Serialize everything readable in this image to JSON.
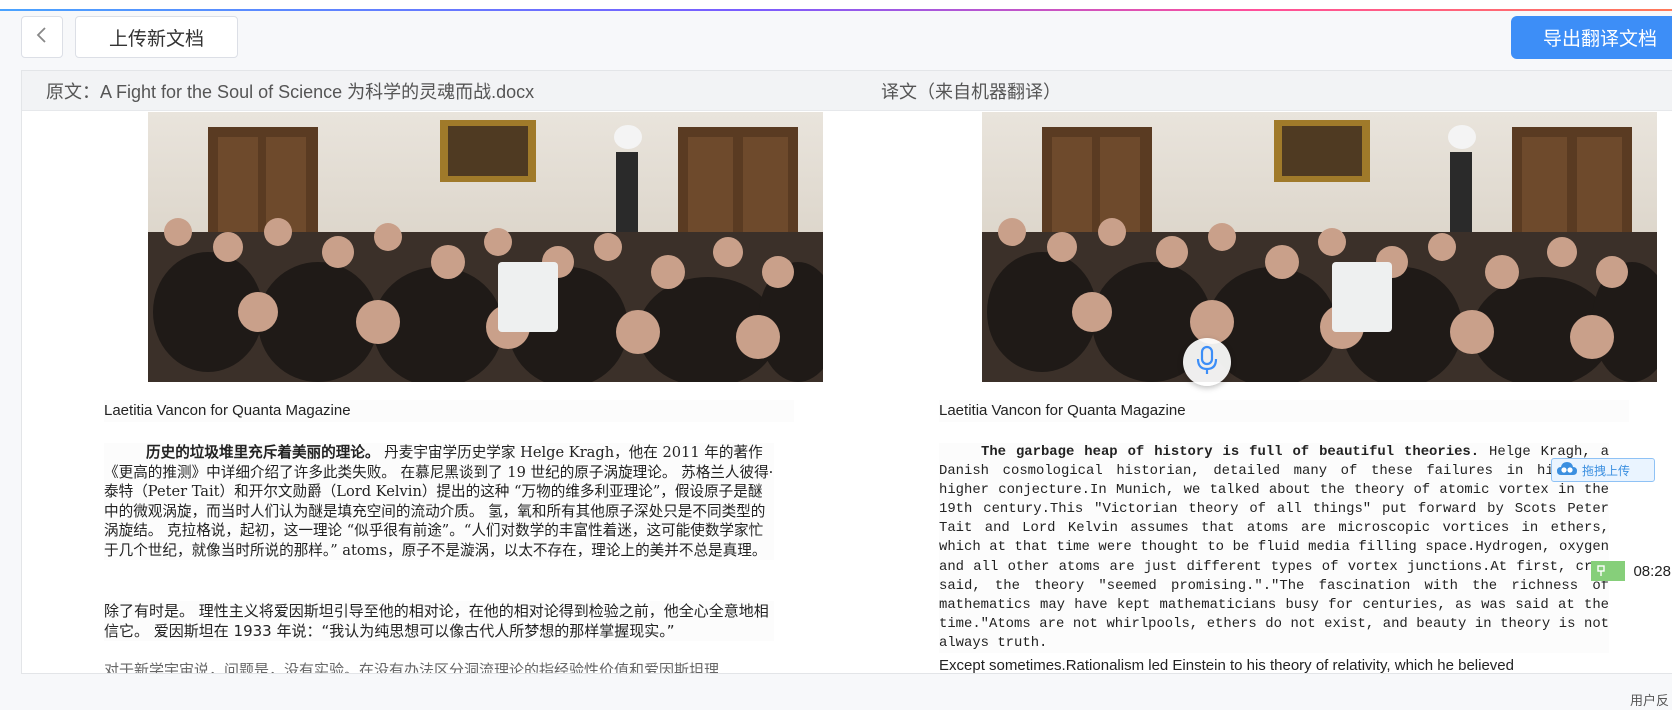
{
  "toolbar": {
    "upload_label": "上传新文档",
    "export_label": "导出翻译文档"
  },
  "colors": {
    "accent": "#3d8ef7",
    "time_badge": "#86cf7a"
  },
  "left_panel": {
    "header": "原文：A Fight for the Soul of Science 为科学的灵魂而战.docx",
    "photo_credit": "Laetitia Vancon for Quanta Magazine",
    "para1_bold": "历史的垃圾堆里充斥着美丽的理论。",
    "para1_rest": " 丹麦宇宙学历史学家 Helge Kragh，他在 2011 年的著作《更高的推测》中详细介绍了许多此类失败。 在慕尼黑谈到了 19 世纪的原子涡旋理论。 苏格兰人彼得·泰特（Peter Tait）和开尔文勋爵（Lord Kelvin）提出的这种 “万物的维多利亚理论”，假设原子是醚中的微观涡旋，而当时人们认为醚是填充空间的流动介质。 氢，氧和所有其他原子深处只是不同类型的涡旋结。 克拉格说，起初，这一理论 “似乎很有前途”。“人们对数学的丰富性着迷，这可能使数学家忙于几个世纪，就像当时所说的那样。” atoms，原子不是漩涡，以太不存在，理论上的美并不总是真理。",
    "para2": "除了有时是。 理性主义将爱因斯坦引导至他的相对论，在他的相对论得到检验之前，他全心全意地相信它。 爱因斯坦在 1933 年说：“我认为纯思想可以像古代人所梦想的那样掌握现实。”",
    "para3": "对于新学宇宙说，问题是，没有实验。在没有办法区分洞流理论的指经验性价值和爱因斯坦理"
  },
  "right_panel": {
    "header": "译文（来自机器翻译）",
    "photo_credit": "Laetitia Vancon for Quanta Magazine",
    "para1_bold": "The garbage heap of history is full of beautiful theories.",
    "para1_rest": " Helge Kragh, a Danish cosmological historian, detailed many of these failures in his Book higher conjecture.In Munich, we talked about the theory of atomic vortex in the 19th century.This \"Victorian theory of all things\" put forward by Scots Peter Tait and Lord Kelvin assumes that atoms are microscopic vortices in ethers, which at that time were thought to be fluid media filling space.Hydrogen, oxygen and all other atoms are just different types of vortex junctions.At first, crag said, the theory \"seemed promising.\".\"The fascination with the richness of mathematics may have kept mathematicians busy for centuries, as was said at the time.\"Atoms are not whirlpools, ethers do not exist, and beauty in theory is not always truth.",
    "para2": "Except sometimes.Rationalism led Einstein to his theory of relativity, which he believed"
  },
  "floating": {
    "drag_upload_label": "拖拽上传",
    "time": "08:28",
    "user_corner": "用户反"
  },
  "icons": {
    "back": "chevron-left-icon",
    "mic": "microphone-icon",
    "cloud": "cloud-upload-icon",
    "pin": "pin-icon"
  }
}
